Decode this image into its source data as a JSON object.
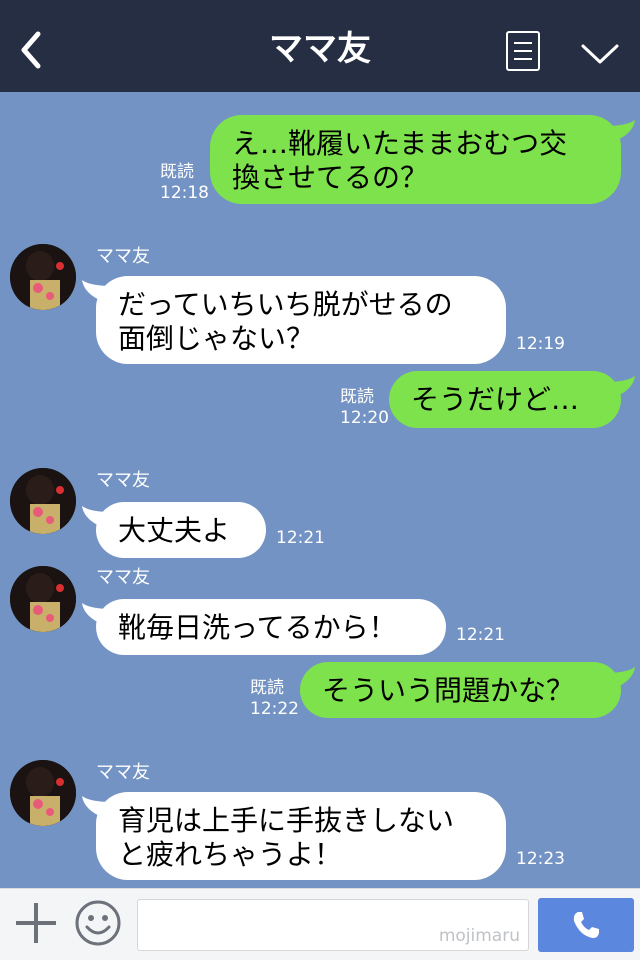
{
  "header": {
    "title": "ママ友"
  },
  "messages": {
    "m1": {
      "text": "え…靴履いたままおむつ交\n換させてるの？",
      "read": "既読",
      "time": "12:18"
    },
    "m2": {
      "sender": "ママ友",
      "text": "だっていちいち脱がせるの\n面倒じゃない？",
      "time": "12:19"
    },
    "m3": {
      "text": "そうだけど…",
      "read": "既読",
      "time": "12:20"
    },
    "m4": {
      "sender": "ママ友",
      "text": "大丈夫よ",
      "time": "12:21"
    },
    "m5": {
      "sender": "ママ友",
      "text": "靴毎日洗ってるから！",
      "time": "12:21"
    },
    "m6": {
      "text": "そういう問題かな？",
      "read": "既読",
      "time": "12:22"
    },
    "m7": {
      "sender": "ママ友",
      "text": "育児は上手に手抜きしない\nと疲れちゃうよ！",
      "time": "12:23"
    }
  },
  "input": {
    "watermark": "mojimaru"
  },
  "icons": {
    "back": "chevron-left-icon",
    "menu": "list-icon",
    "collapse": "chevron-down-icon",
    "add": "plus-icon",
    "emoji": "smiley-icon",
    "send": "phone-icon"
  },
  "colors": {
    "header": "#262e43",
    "chat_background": "#7393c4",
    "outgoing_bubble": "#7ee24c",
    "incoming_bubble": "#ffffff",
    "send_button": "#5b87df"
  }
}
